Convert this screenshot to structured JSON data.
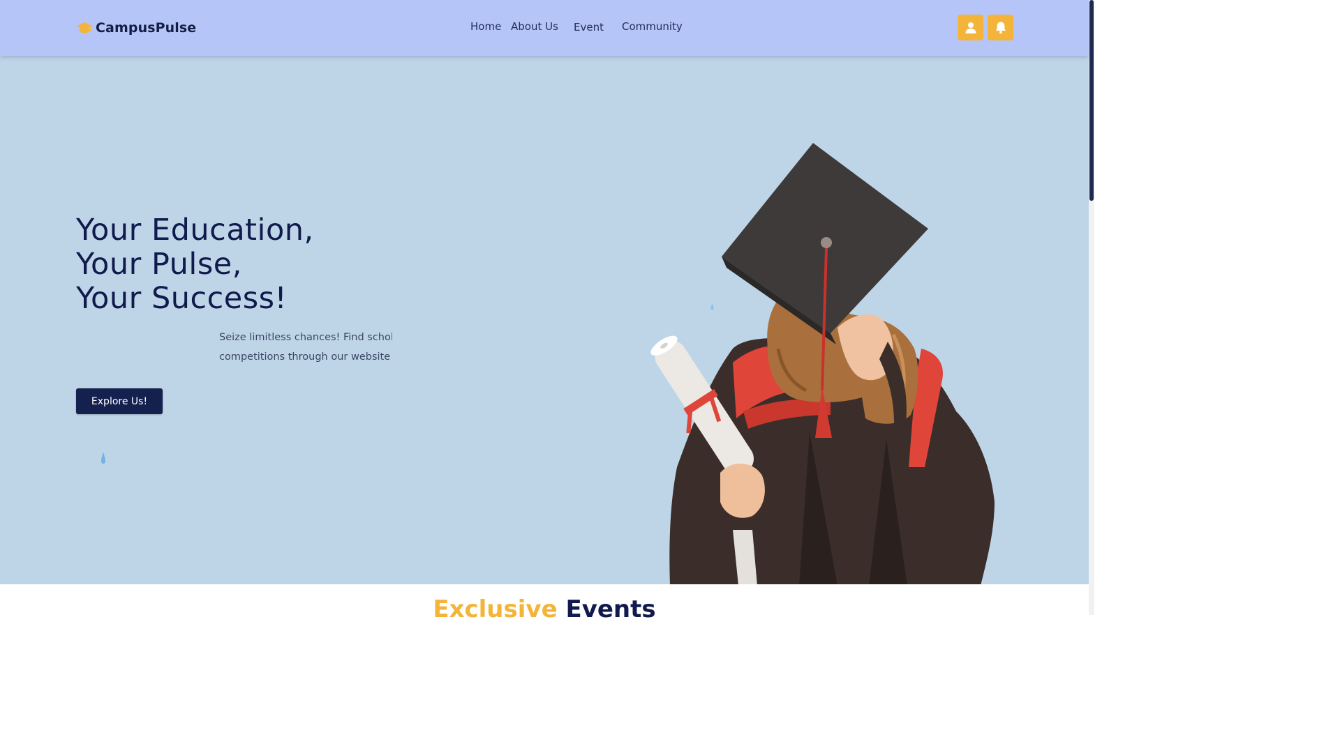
{
  "brand": {
    "name": "CampusPulse",
    "icon": "graduation-cap-icon",
    "accent_color": "#f3b439"
  },
  "nav": {
    "links": [
      {
        "label": "Home"
      },
      {
        "label": "About Us"
      },
      {
        "label": "Event"
      },
      {
        "label": "Community"
      }
    ],
    "actions": [
      {
        "icon": "user-icon"
      },
      {
        "icon": "bell-icon"
      }
    ]
  },
  "hero": {
    "title_lines": [
      "Your Education,",
      "Your Pulse,",
      "Your Success!"
    ],
    "description_lines": [
      "Seize limitless chances! Find schola",
      "competitions through our website -"
    ],
    "cta_label": "Explore Us!",
    "image": "graduate-with-diploma"
  },
  "events": {
    "heading_accent": "Exclusive",
    "heading_rest": "Events"
  },
  "colors": {
    "navbar_bg": "#b6c5f7",
    "hero_bg": "#bed5e8",
    "primary_dark": "#101a4c",
    "accent": "#f3b439"
  }
}
